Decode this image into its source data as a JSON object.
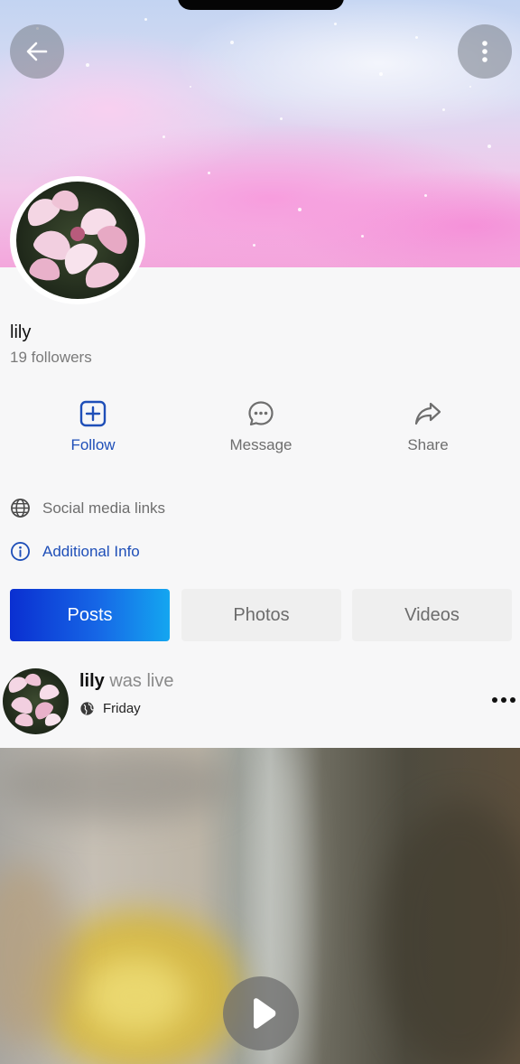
{
  "header": {
    "back_icon": "arrow-left-icon",
    "more_icon": "vertical-dots-icon"
  },
  "profile": {
    "name": "lily",
    "followers": "19 followers"
  },
  "actions": [
    {
      "label": "Follow",
      "icon": "plus-square-icon",
      "color": "#1f4fb8"
    },
    {
      "label": "Message",
      "icon": "chat-bubble-icon"
    },
    {
      "label": "Share",
      "icon": "share-arrow-icon"
    }
  ],
  "info": {
    "social_links": "Social media links",
    "additional_info": "Additional Info"
  },
  "tabs": [
    {
      "label": "Posts",
      "active": true
    },
    {
      "label": "Photos",
      "active": false
    },
    {
      "label": "Videos",
      "active": false
    }
  ],
  "post": {
    "author": "lily",
    "action_text": "was live",
    "time": "Friday",
    "privacy_icon": "globe-icon",
    "more_icon": "horizontal-dots-icon"
  },
  "video": {
    "play_icon": "play-icon"
  },
  "colors": {
    "accent": "#1f4fb8",
    "tab_gradient_start": "#0a2fd1",
    "tab_gradient_end": "#14a6f0"
  }
}
